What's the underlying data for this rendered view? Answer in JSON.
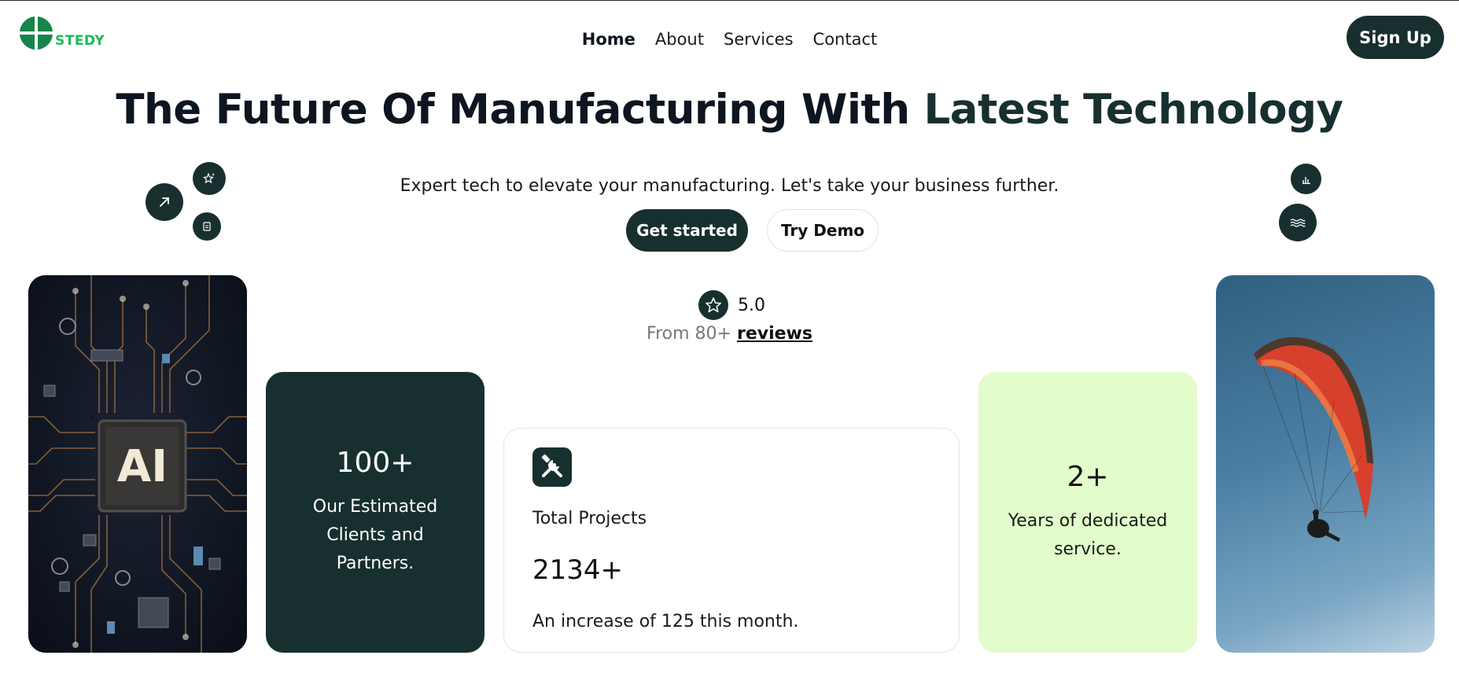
{
  "brand": {
    "name": "STEDY",
    "colors": {
      "primary": "#17302f",
      "logo": "#1db954",
      "lime": "#e2fccb"
    }
  },
  "nav": {
    "items": [
      {
        "label": "Home",
        "active": true
      },
      {
        "label": "About"
      },
      {
        "label": "Services"
      },
      {
        "label": "Contact"
      }
    ],
    "signup_label": "Sign Up"
  },
  "hero": {
    "title_main": "The Future Of Manufacturing With ",
    "title_accent": "Latest Technology",
    "subtitle": "Expert tech to elevate your manufacturing. Let's take your business further.",
    "primary_cta": "Get started",
    "secondary_cta": "Try Demo"
  },
  "floating_icons": [
    "arrow-up-right-icon",
    "sparkle-star-icon",
    "document-icon",
    "bar-chart-icon",
    "waves-icon"
  ],
  "rating": {
    "value": "5.0",
    "prefix": "From 80+",
    "link": "reviews"
  },
  "cards": {
    "image_left": {
      "icon": "ai-chip-image",
      "chip_text": "AI"
    },
    "clients": {
      "number": "100+",
      "label": "Our Estimated Clients and Partners."
    },
    "projects": {
      "icon": "tools-icon",
      "title": "Total Projects",
      "number": "2134+",
      "note": "An increase of 125 this month."
    },
    "years": {
      "number": "2+",
      "label": "Years of dedicated service."
    },
    "image_right": {
      "icon": "paraglider-image"
    }
  }
}
